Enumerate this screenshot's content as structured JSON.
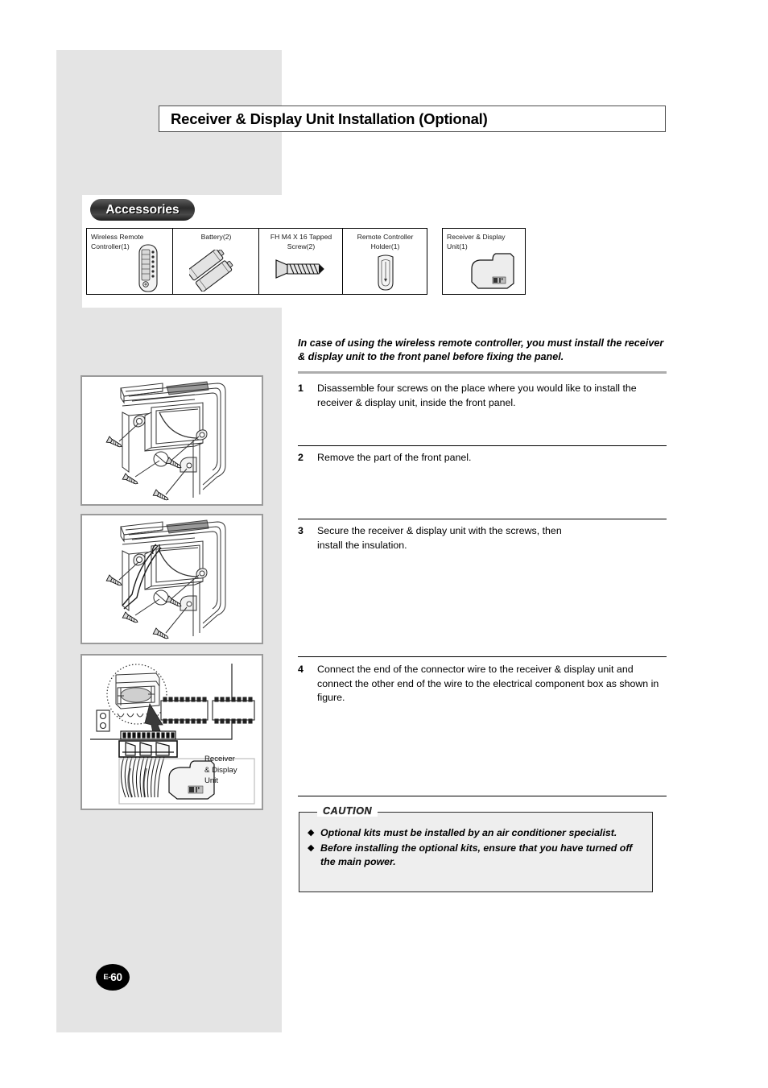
{
  "page": {
    "title": "Receiver & Display Unit Installation (Optional)",
    "number_prefix": "E-",
    "number": "60"
  },
  "accessories": {
    "section_label": "Accessories",
    "items": [
      {
        "label_line1": "Wireless Remote",
        "label_line2": "Controller(1)",
        "icon": "remote-controller-icon",
        "align": "left"
      },
      {
        "label_line1": "Battery(2)",
        "label_line2": "",
        "icon": "battery-pair-icon",
        "align": "center"
      },
      {
        "label_line1": "FH M4 X 16 Tapped",
        "label_line2": "Screw(2)",
        "icon": "tapped-screw-icon",
        "align": "center"
      },
      {
        "label_line1": "Remote Controller",
        "label_line2": "Holder(1)",
        "icon": "remote-holder-icon",
        "align": "center"
      }
    ],
    "separate_item": {
      "label_line1": "Receiver & Display",
      "label_line2": "Unit(1)",
      "icon": "receiver-display-unit-icon"
    }
  },
  "intro": "In case of using the wireless remote controller, you must install the receiver & display unit to the front panel before fixing the panel.",
  "steps": [
    {
      "num": "1",
      "text": "Disassemble four screws on the place where you would like to install the receiver & display unit, inside the front panel."
    },
    {
      "num": "2",
      "text": "Remove the part of the front panel."
    },
    {
      "num": "3",
      "text": "Secure the receiver & display unit with the screws, then install the insulation."
    },
    {
      "num": "4",
      "text": "Connect the end of the connector wire to the receiver & display unit and connect the other end of the wire to the electrical component box as shown in figure."
    }
  ],
  "illustrations": [
    {
      "name": "front-panel-screws-diagram",
      "caption": ""
    },
    {
      "name": "front-panel-wires-diagram",
      "caption": ""
    },
    {
      "name": "connector-wiring-diagram",
      "caption_line1": "Receiver",
      "caption_line2": "& Display",
      "caption_line3": "Unit"
    }
  ],
  "caution": {
    "heading": "CAUTION",
    "bullet_glyph": "◆",
    "items": [
      "Optional kits must be installed by an air conditioner specialist.",
      "Before installing the optional kits, ensure that you have turned off the main power."
    ]
  },
  "colors": {
    "page_gray": "#e4e4e4",
    "frame_gray": "#9a9a9a",
    "separator_gray": "#adadad",
    "ink": "#000000",
    "caution_bg": "#eeeeee"
  }
}
